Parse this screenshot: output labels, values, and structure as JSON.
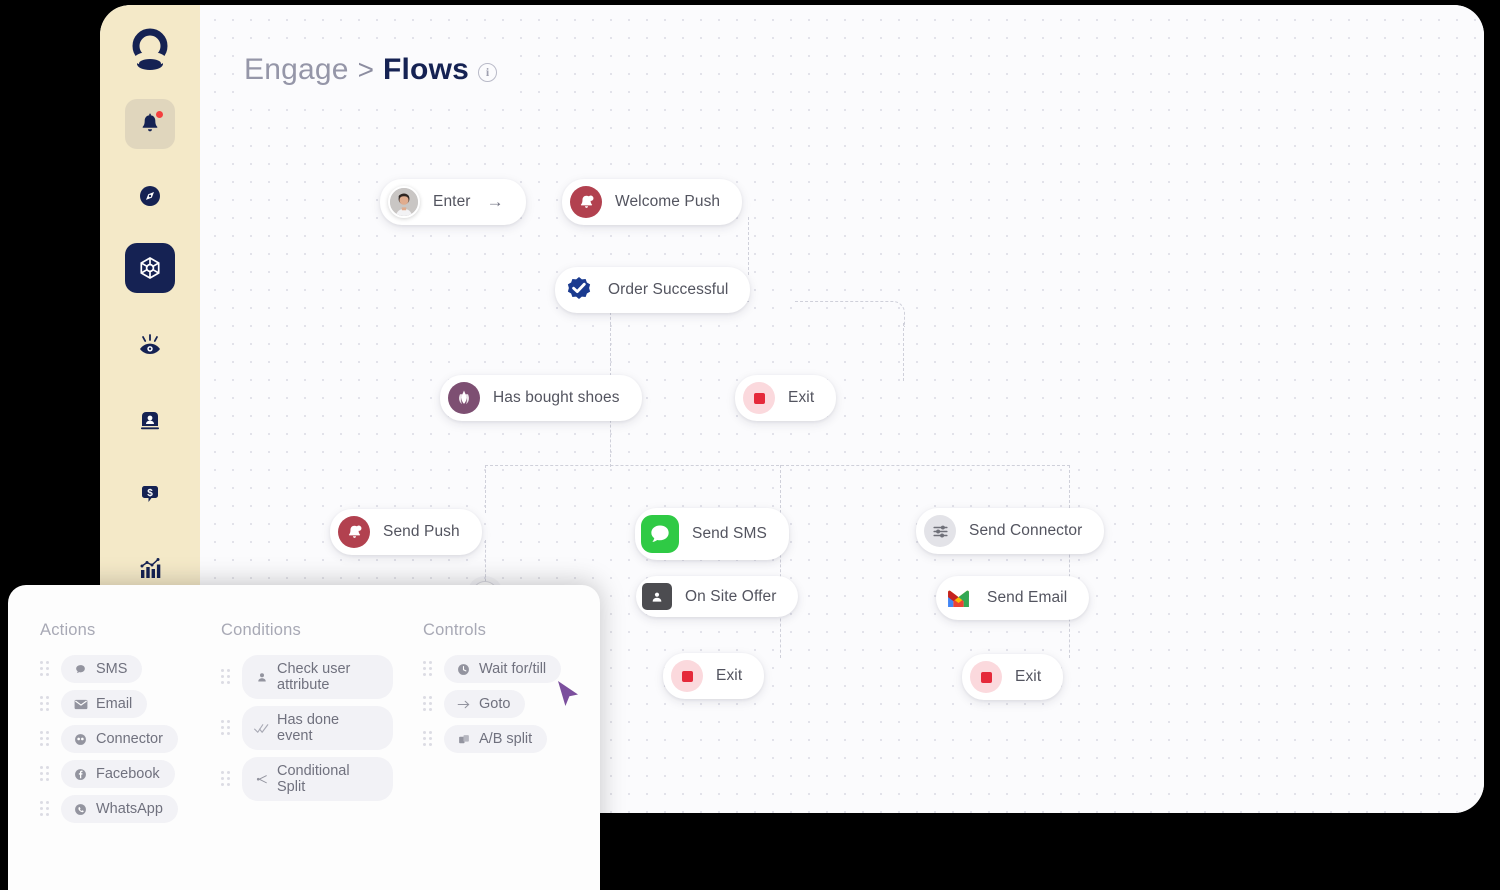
{
  "header": {
    "breadcrumb_parent": "Engage",
    "breadcrumb_separator": ">",
    "breadcrumb_current": "Flows",
    "info_glyph": "i"
  },
  "sidebar": {
    "logo_name": "brand-logo",
    "items": [
      {
        "name": "notifications",
        "icon": "bell-icon",
        "active": true,
        "badge": true
      },
      {
        "name": "explore",
        "icon": "compass-icon",
        "active": false,
        "badge": false
      },
      {
        "name": "flows",
        "icon": "flow-network-icon",
        "active": true,
        "badge": false
      },
      {
        "name": "insights",
        "icon": "eye-icon",
        "active": false,
        "badge": false
      },
      {
        "name": "audience",
        "icon": "user-card-icon",
        "active": false,
        "badge": false
      },
      {
        "name": "revenue",
        "icon": "dollar-chat-icon",
        "active": false,
        "badge": false
      },
      {
        "name": "analytics",
        "icon": "bar-chart-icon",
        "active": false,
        "badge": false
      }
    ]
  },
  "flow": {
    "add_button_label": "+",
    "nodes": [
      {
        "id": "enter",
        "label": "Enter",
        "icon": "user-avatar-icon",
        "trailing": "→"
      },
      {
        "id": "welcome",
        "label": "Welcome Push",
        "icon": "bell-push-icon"
      },
      {
        "id": "order",
        "label": "Order Successful",
        "icon": "verified-check-icon"
      },
      {
        "id": "shoes",
        "label": "Has bought shoes",
        "icon": "condition-icon"
      },
      {
        "id": "exit1",
        "label": "Exit",
        "icon": "stop-square-icon"
      },
      {
        "id": "sendpush",
        "label": "Send Push",
        "icon": "bell-push-icon"
      },
      {
        "id": "sendsms",
        "label": "Send SMS",
        "icon": "chat-bubble-icon"
      },
      {
        "id": "sendconn",
        "label": "Send Connector",
        "icon": "sliders-icon"
      },
      {
        "id": "onsite",
        "label": "On Site Offer",
        "icon": "onsite-badge-icon"
      },
      {
        "id": "sendemail",
        "label": "Send Email",
        "icon": "gmail-icon"
      },
      {
        "id": "exit2",
        "label": "Exit",
        "icon": "stop-square-icon"
      },
      {
        "id": "exit3",
        "label": "Exit",
        "icon": "stop-square-icon"
      }
    ]
  },
  "palette": {
    "columns": [
      {
        "title": "Actions",
        "items": [
          {
            "label": "SMS",
            "icon": "chat-bubble-icon"
          },
          {
            "label": "Email",
            "icon": "envelope-icon"
          },
          {
            "label": "Connector",
            "icon": "connector-icon"
          },
          {
            "label": "Facebook",
            "icon": "facebook-icon"
          },
          {
            "label": "WhatsApp",
            "icon": "whatsapp-icon"
          }
        ]
      },
      {
        "title": "Conditions",
        "items": [
          {
            "label": "Check user attribute",
            "icon": "person-icon"
          },
          {
            "label": "Has done event",
            "icon": "double-check-icon"
          },
          {
            "label": "Conditional Split",
            "icon": "split-icon"
          }
        ]
      },
      {
        "title": "Controls",
        "items": [
          {
            "label": "Wait for/till",
            "icon": "clock-icon"
          },
          {
            "label": "Goto",
            "icon": "arrow-right-icon"
          },
          {
            "label": "A/B split",
            "icon": "ab-split-icon"
          }
        ]
      }
    ]
  },
  "colors": {
    "sidebar_bg": "#f4e9c8",
    "brand_navy": "#152253",
    "canvas_bg": "#fbfbfd",
    "accent_red": "#f43f3f",
    "sms_green": "#2fca45",
    "cursor_purple": "#7b4f9d"
  }
}
